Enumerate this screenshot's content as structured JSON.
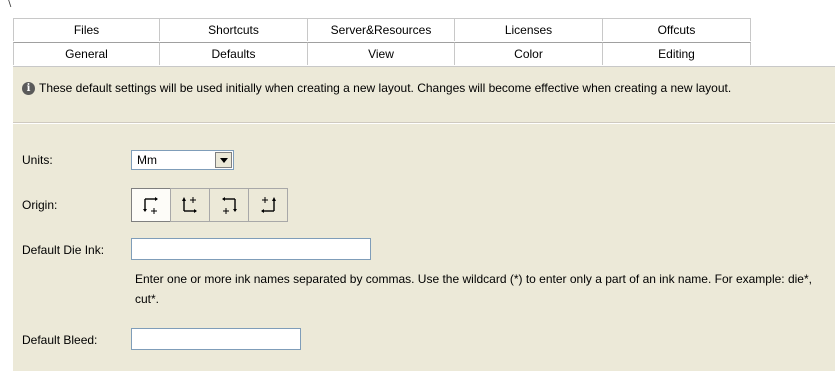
{
  "tabs": {
    "back_row": [
      "Files",
      "Shortcuts",
      "Server&Resources",
      "Licenses",
      "Offcuts"
    ],
    "front_row": [
      "General",
      "Defaults",
      "View",
      "Color",
      "Editing"
    ],
    "active": "Defaults"
  },
  "info": {
    "icon": "info-icon",
    "text": "These default settings will be used initially when creating a new layout. Changes will become effective when creating a new layout."
  },
  "units": {
    "label": "Units:",
    "value": "Mm"
  },
  "origin": {
    "label": "Origin:",
    "options": [
      "origin-top-left-icon",
      "origin-bottom-left-icon",
      "origin-top-right-icon",
      "origin-bottom-right-icon"
    ],
    "selected_index": 0
  },
  "die_ink": {
    "label": "Default Die Ink:",
    "value": "",
    "help": "Enter one or more ink names separated by commas. Use the wildcard (*) to enter only a part of an ink name. For example: die*, cut*."
  },
  "bleed": {
    "label": "Default Bleed:",
    "value": ""
  }
}
